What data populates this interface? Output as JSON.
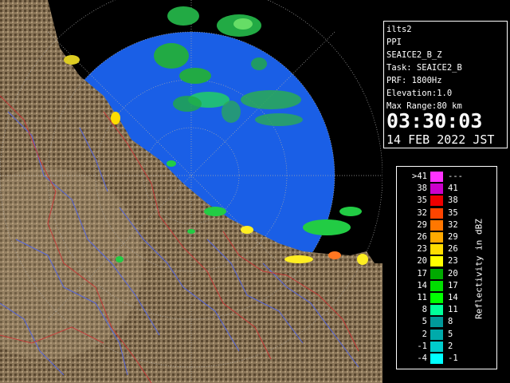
{
  "info": {
    "site": "ilts2",
    "scan_type": "PPI",
    "product": "SEAICE2_B_Z",
    "task": "Task: SEAICE2_B",
    "prf": "PRF: 1800Hz",
    "elevation": "Elevation:1.0",
    "max_range": "Max Range:80 km",
    "time": "03:30:03",
    "date": "14 FEB 2022 JST"
  },
  "legend": {
    "unit_label": "Reflectivity in dBZ",
    "rows": [
      {
        "lo": ">41",
        "hi": "---",
        "color": "#ff33ff"
      },
      {
        "lo": "38",
        "hi": "41",
        "color": "#cc00cc"
      },
      {
        "lo": "35",
        "hi": "38",
        "color": "#ee0000"
      },
      {
        "lo": "32",
        "hi": "35",
        "color": "#ff4400"
      },
      {
        "lo": "29",
        "hi": "32",
        "color": "#ff7700"
      },
      {
        "lo": "26",
        "hi": "29",
        "color": "#ffaa00"
      },
      {
        "lo": "23",
        "hi": "26",
        "color": "#ffdd00"
      },
      {
        "lo": "20",
        "hi": "23",
        "color": "#ffff00"
      },
      {
        "lo": "17",
        "hi": "20",
        "color": "#00aa00"
      },
      {
        "lo": "14",
        "hi": "17",
        "color": "#00dd00"
      },
      {
        "lo": "11",
        "hi": "14",
        "color": "#00ff00"
      },
      {
        "lo": "8",
        "hi": "11",
        "color": "#00ff99"
      },
      {
        "lo": "5",
        "hi": "8",
        "color": "#009999"
      },
      {
        "lo": "2",
        "hi": "5",
        "color": "#00aaaa"
      },
      {
        "lo": "-1",
        "hi": "2",
        "color": "#00cccc"
      },
      {
        "lo": "-4",
        "hi": "-1",
        "color": "#00ffff"
      }
    ]
  },
  "colors": {
    "sea": "#1a5fe6",
    "land": "#8a7558",
    "land_dark": "#4a3a22",
    "river": "#5566dd",
    "boundary": "#cc3333",
    "echo_green": "#22cc44"
  }
}
